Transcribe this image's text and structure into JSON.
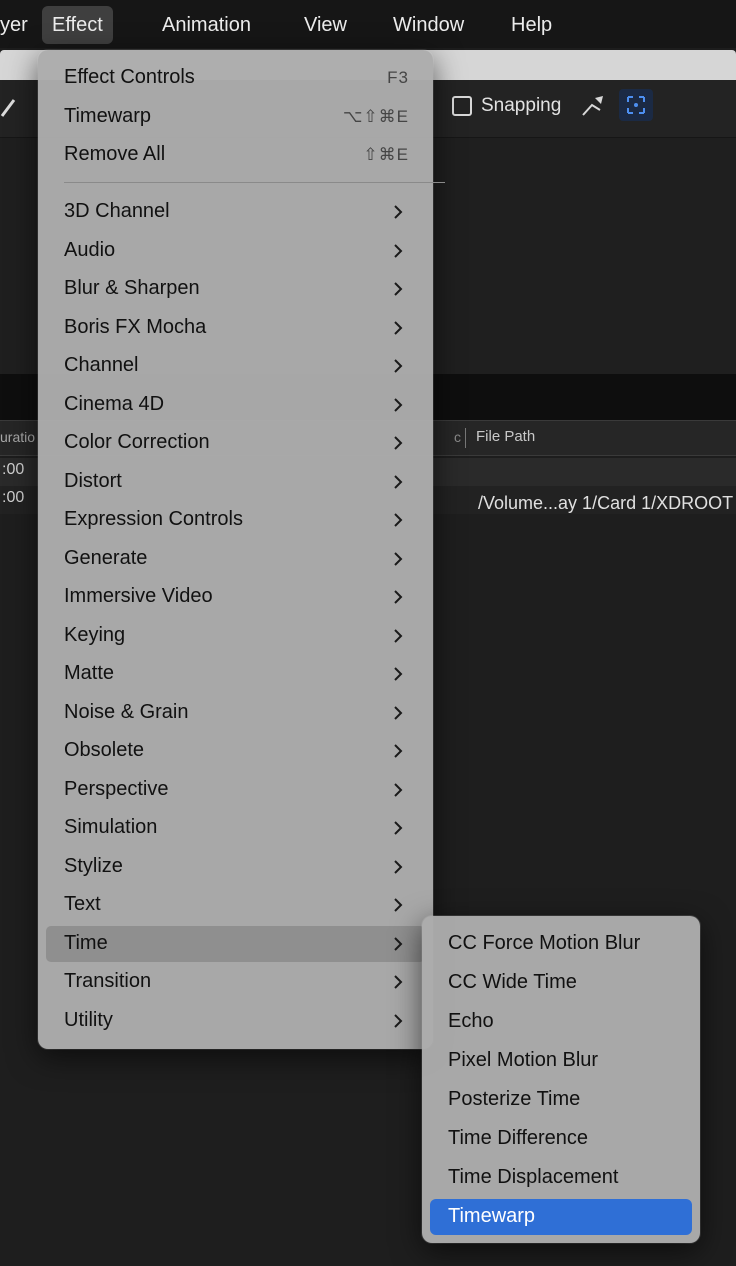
{
  "menubar": {
    "items": [
      {
        "label": "yer"
      },
      {
        "label": "Effect"
      },
      {
        "label": "Animation"
      },
      {
        "label": "View"
      },
      {
        "label": "Window"
      },
      {
        "label": "Help"
      }
    ]
  },
  "toolbar": {
    "snapping_label": "Snapping",
    "snapping_checked": false
  },
  "project_panel": {
    "col_duration": "uratio",
    "col_c": "c",
    "col_file_path": "File Path",
    "rows": [
      {
        "duration": ":00",
        "file_path": ""
      },
      {
        "duration": ":00",
        "file_path": "/Volume...ay 1/Card 1/XDROOT"
      }
    ]
  },
  "effect_menu": {
    "top_items": [
      {
        "label": "Effect Controls",
        "shortcut": "F3"
      },
      {
        "label": "Timewarp",
        "shortcut": "⌥⇧⌘E"
      },
      {
        "label": "Remove All",
        "shortcut": "⇧⌘E"
      }
    ],
    "categories": [
      {
        "label": "3D Channel"
      },
      {
        "label": "Audio"
      },
      {
        "label": "Blur & Sharpen"
      },
      {
        "label": "Boris FX Mocha"
      },
      {
        "label": "Channel"
      },
      {
        "label": "Cinema 4D"
      },
      {
        "label": "Color Correction"
      },
      {
        "label": "Distort"
      },
      {
        "label": "Expression Controls"
      },
      {
        "label": "Generate"
      },
      {
        "label": "Immersive Video"
      },
      {
        "label": "Keying"
      },
      {
        "label": "Matte"
      },
      {
        "label": "Noise & Grain"
      },
      {
        "label": "Obsolete"
      },
      {
        "label": "Perspective"
      },
      {
        "label": "Simulation"
      },
      {
        "label": "Stylize"
      },
      {
        "label": "Text"
      },
      {
        "label": "Time"
      },
      {
        "label": "Transition"
      },
      {
        "label": "Utility"
      }
    ],
    "highlighted": "Time"
  },
  "time_submenu": {
    "items": [
      {
        "label": "CC Force Motion Blur"
      },
      {
        "label": "CC Wide Time"
      },
      {
        "label": "Echo"
      },
      {
        "label": "Pixel Motion Blur"
      },
      {
        "label": "Posterize Time"
      },
      {
        "label": "Time Difference"
      },
      {
        "label": "Time Displacement"
      },
      {
        "label": "Timewarp"
      }
    ],
    "selected": "Timewarp"
  },
  "colors": {
    "menu_bg": "#acacac",
    "highlight": "#8f8f8f",
    "selection": "#2f6fd6"
  }
}
